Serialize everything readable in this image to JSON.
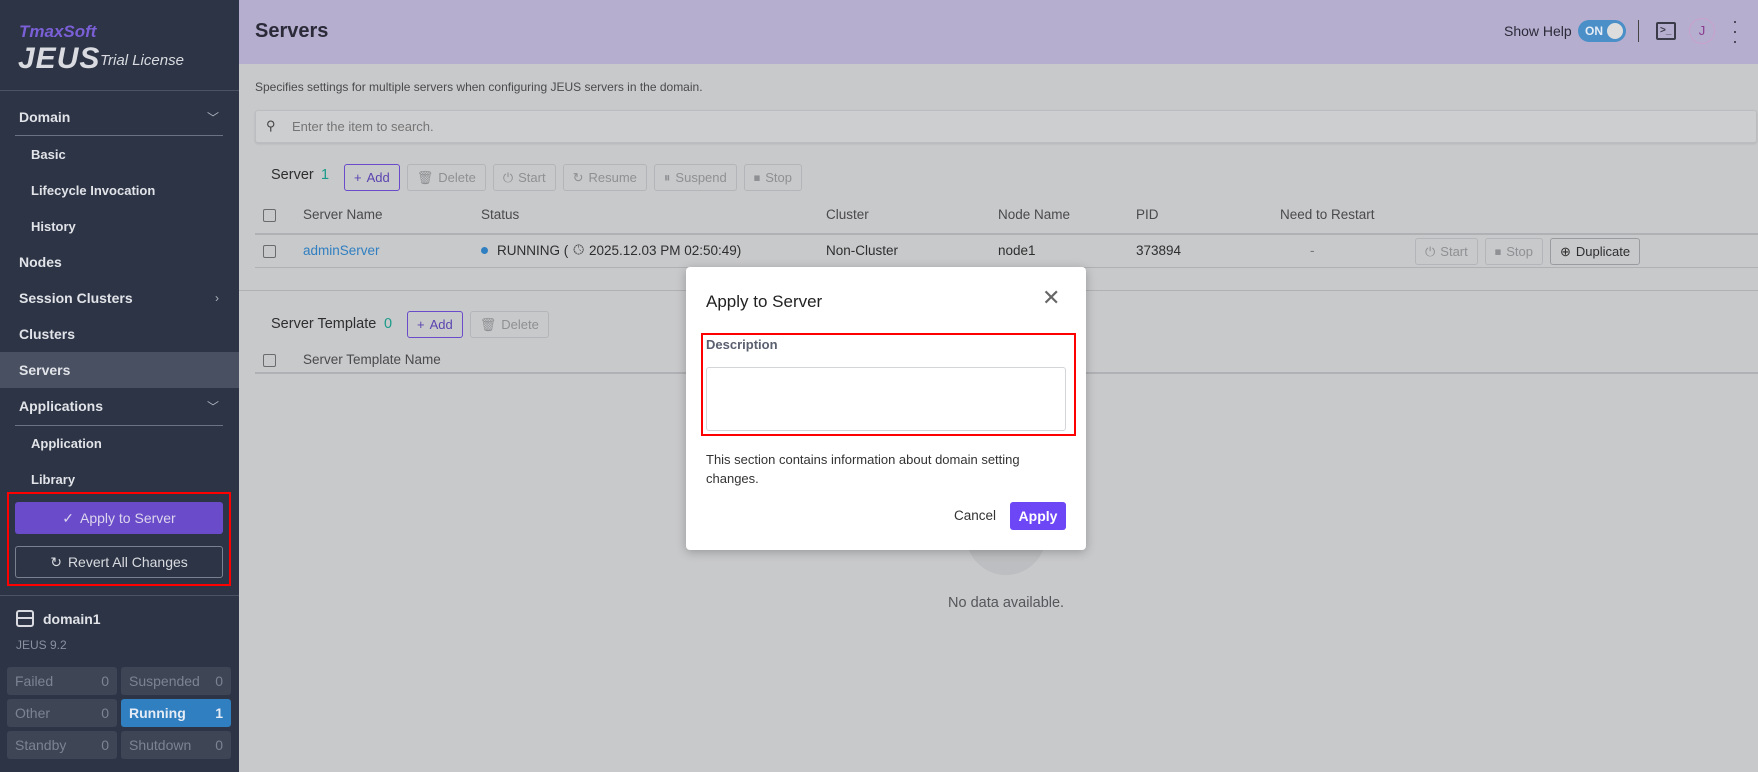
{
  "logo": {
    "brand": "TmaxSoft",
    "product": "JEUS",
    "license": "Trial License"
  },
  "sidebar": {
    "items": [
      {
        "label": "Domain",
        "expanded": true
      },
      {
        "label": "Basic"
      },
      {
        "label": "Lifecycle Invocation"
      },
      {
        "label": "History"
      },
      {
        "label": "Nodes"
      },
      {
        "label": "Session Clusters"
      },
      {
        "label": "Clusters"
      },
      {
        "label": "Servers",
        "selected": true
      },
      {
        "label": "Applications",
        "expanded": true
      },
      {
        "label": "Application"
      },
      {
        "label": "Library"
      }
    ],
    "apply_label": "Apply to Server",
    "revert_label": "Revert All Changes",
    "domain_name": "domain1",
    "version": "JEUS 9.2",
    "stats": [
      {
        "label": "Failed",
        "count": "0"
      },
      {
        "label": "Suspended",
        "count": "0"
      },
      {
        "label": "Other",
        "count": "0"
      },
      {
        "label": "Running",
        "count": "1"
      },
      {
        "label": "Standby",
        "count": "0"
      },
      {
        "label": "Shutdown",
        "count": "0"
      }
    ]
  },
  "header": {
    "title": "Servers",
    "show_help": "Show Help",
    "toggle": "ON",
    "avatar": "J"
  },
  "main": {
    "description": "Specifies settings for multiple servers when configuring JEUS servers in the domain.",
    "search_placeholder": "Enter the item to search.",
    "server": {
      "title": "Server",
      "count": "1",
      "buttons": [
        "Add",
        "Delete",
        "Start",
        "Resume",
        "Suspend",
        "Stop"
      ],
      "columns": [
        "Server Name",
        "Status",
        "Cluster",
        "Node Name",
        "PID",
        "Need to Restart"
      ],
      "rows": [
        {
          "name": "adminServer",
          "status": "RUNNING (",
          "time": "2025.12.03 PM 02:50:49)",
          "cluster": "Non-Cluster",
          "node": "node1",
          "pid": "373894",
          "restart": "-",
          "actions": [
            "Start",
            "Stop",
            "Duplicate"
          ]
        }
      ]
    },
    "template": {
      "title": "Server Template",
      "count": "0",
      "buttons": [
        "Add",
        "Delete"
      ],
      "columns": [
        "Server Template Name"
      ],
      "empty": "No data available."
    }
  },
  "dialog": {
    "title": "Apply to Server",
    "field_label": "Description",
    "value": "",
    "help": "This section contains information about domain setting changes.",
    "cancel": "Cancel",
    "apply": "Apply"
  },
  "colors": {
    "accent": "#6a4bc9",
    "running": "#2f7fc1",
    "highlight": "#ff0000",
    "count": "#1a9b8a"
  }
}
